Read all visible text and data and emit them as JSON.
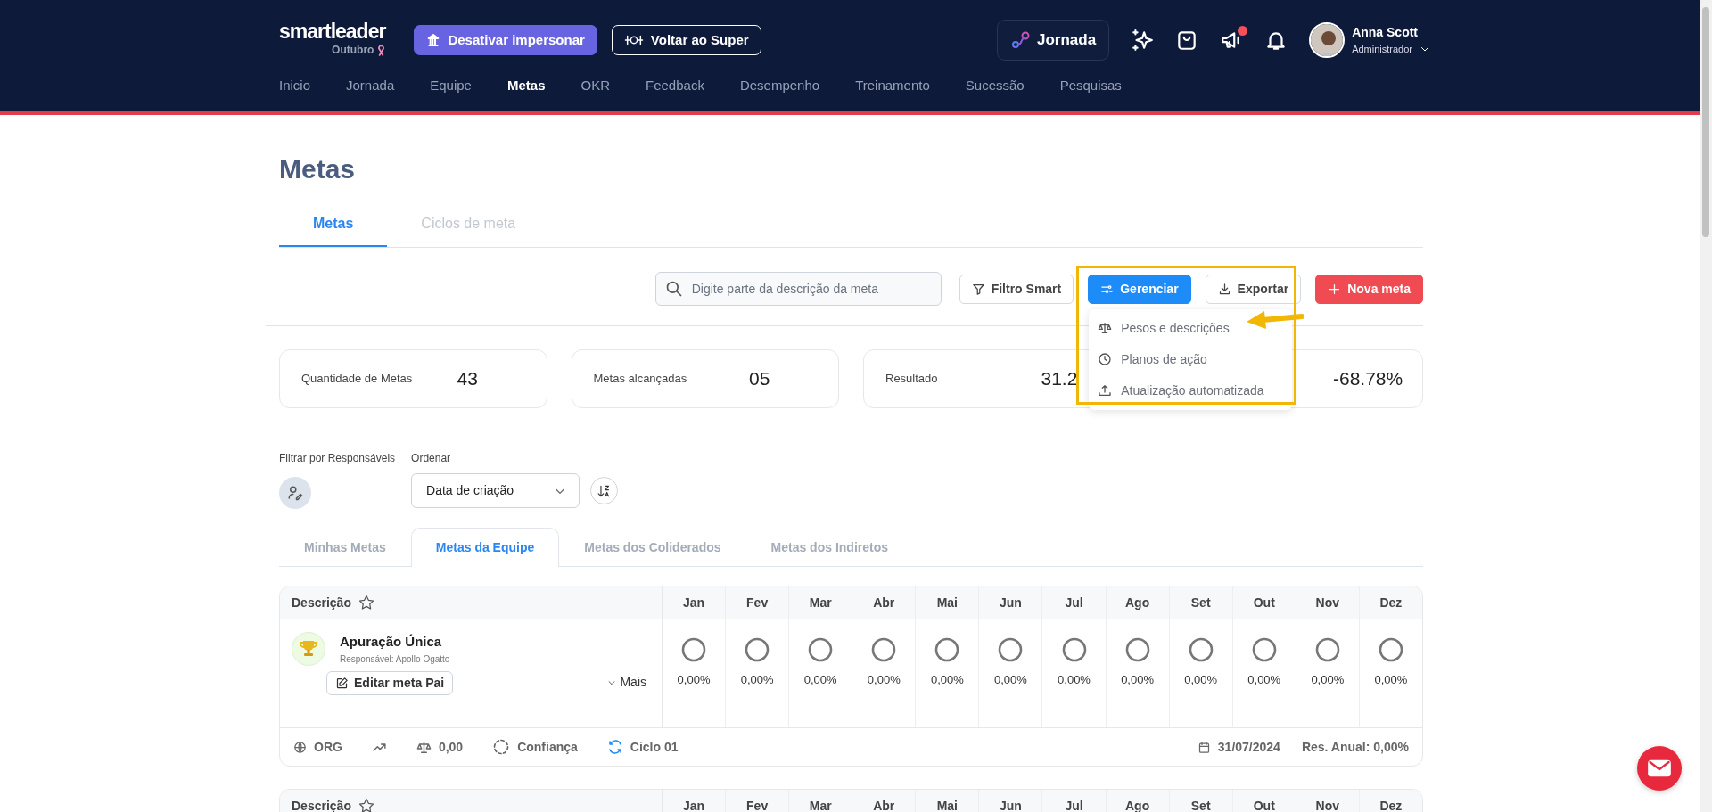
{
  "brand": {
    "name": "smartleader",
    "subtitle": "Outubro"
  },
  "header_buttons": [
    {
      "kind": "impersonate",
      "label": "Desativar impersonar"
    },
    {
      "kind": "super",
      "label": "Voltar ao Super"
    }
  ],
  "journey_button": {
    "label": "Jornada"
  },
  "header_icons": [
    {
      "kind": "sparkle",
      "unread": false
    },
    {
      "kind": "bag",
      "unread": false
    },
    {
      "kind": "megaphone",
      "unread": true
    },
    {
      "kind": "bell",
      "unread": false
    }
  ],
  "user": {
    "name": "Anna Scott",
    "role": "Administrador"
  },
  "nav": [
    {
      "label": "Inicio",
      "selected": false
    },
    {
      "label": "Jornada",
      "selected": false
    },
    {
      "label": "Equipe",
      "selected": false
    },
    {
      "label": "Metas",
      "selected": true
    },
    {
      "label": "OKR",
      "selected": false
    },
    {
      "label": "Feedback",
      "selected": false
    },
    {
      "label": "Desempenho",
      "selected": false
    },
    {
      "label": "Treinamento",
      "selected": false
    },
    {
      "label": "Sucessão",
      "selected": false
    },
    {
      "label": "Pesquisas",
      "selected": false
    }
  ],
  "page_title": "Metas",
  "page_tabs": [
    {
      "label": "Metas",
      "selected": true
    },
    {
      "label": "Ciclos de meta",
      "selected": false
    }
  ],
  "search": {
    "placeholder": "Digite parte da descrição da meta"
  },
  "toolbar": [
    {
      "kind": "filter",
      "label": "Filtro Smart"
    },
    {
      "kind": "manage",
      "label": "Gerenciar"
    },
    {
      "kind": "export",
      "label": "Exportar"
    },
    {
      "kind": "new",
      "label": "Nova meta"
    }
  ],
  "manage_menu": {
    "expanded": true,
    "items": [
      {
        "kind": "scale",
        "label": "Pesos e descrições"
      },
      {
        "kind": "clock",
        "label": "Planos de ação"
      },
      {
        "kind": "upload",
        "label": "Atualização automatizada"
      }
    ]
  },
  "annotation": {
    "kind": "highlight-arrow"
  },
  "stats": [
    {
      "label": "Quantidade de Metas",
      "value": "43"
    },
    {
      "label": "Metas alcançadas",
      "value": "05"
    },
    {
      "label": "Resultado",
      "value": "31.2"
    },
    {
      "value": "-68.78%"
    }
  ],
  "filters": {
    "responsible_label": "Filtrar por Responsáveis",
    "order_label": "Ordenar",
    "order_value": "Data de criação"
  },
  "goal_tabs": [
    {
      "label": "Minhas Metas",
      "selected": false
    },
    {
      "label": "Metas da Equipe",
      "selected": true
    },
    {
      "label": "Metas dos Coliderados",
      "selected": false
    },
    {
      "label": "Metas dos Indiretos",
      "selected": false
    }
  ],
  "goals": [
    {
      "columns": [
        "Descrição",
        "Jan",
        "Fev",
        "Mar",
        "Abr",
        "Mai",
        "Jun",
        "Jul",
        "Ago",
        "Set",
        "Out",
        "Nov",
        "Dez"
      ],
      "title": "Apuração Única",
      "responsible": "Responsável: Apollo Ogatto",
      "edit_label": "Editar meta Pai",
      "more_label": "Mais",
      "months": [
        "0,00%",
        "0,00%",
        "0,00%",
        "0,00%",
        "0,00%",
        "0,00%",
        "0,00%",
        "0,00%",
        "0,00%",
        "0,00%",
        "0,00%",
        "0,00%"
      ],
      "footer": {
        "scope": "ORG",
        "weight": "0,00",
        "confidence": "Confiança",
        "cycle": "Ciclo 01",
        "date": "31/07/2024",
        "annual": "Res. Anual: 0,00%"
      }
    },
    {
      "columns": [
        "Descrição",
        "Jan",
        "Fev",
        "Mar",
        "Abr",
        "Mai",
        "Jun",
        "Jul",
        "Ago",
        "Set",
        "Out",
        "Nov",
        "Dez"
      ]
    }
  ]
}
